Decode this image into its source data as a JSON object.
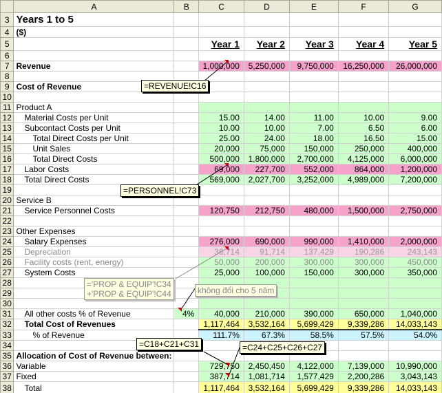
{
  "columns": [
    "",
    "A",
    "B",
    "C",
    "D",
    "E",
    "F",
    "G"
  ],
  "rows": [
    {
      "n": "3",
      "a": "Years 1 to 5",
      "b": "",
      "v": [
        "",
        "",
        "",
        "",
        ""
      ],
      "cls": "big",
      "fill": ""
    },
    {
      "n": "4",
      "a": "($)",
      "b": "",
      "v": [
        "",
        "",
        "",
        "",
        ""
      ],
      "cls": "bold",
      "fill": ""
    },
    {
      "n": "5",
      "a": "",
      "b": "",
      "v": [
        "Year 1",
        "Year 2",
        "Year 3",
        "Year 4",
        "Year 5"
      ],
      "cls": "yr",
      "fill": ""
    },
    {
      "n": "6",
      "a": "",
      "b": "",
      "v": [
        "",
        "",
        "",
        "",
        ""
      ],
      "cls": "",
      "fill": ""
    },
    {
      "n": "7",
      "a": "Revenue",
      "b": "",
      "v": [
        "1,000,000",
        "5,250,000",
        "9,750,000",
        "16,250,000",
        "26,000,000"
      ],
      "cls": "bold",
      "fill": "pink"
    },
    {
      "n": "8",
      "a": "",
      "b": "",
      "v": [
        "",
        "",
        "",
        "",
        ""
      ],
      "cls": "",
      "fill": ""
    },
    {
      "n": "9",
      "a": "Cost of Revenue",
      "b": "",
      "v": [
        "",
        "",
        "",
        "",
        ""
      ],
      "cls": "bold",
      "fill": ""
    },
    {
      "n": "10",
      "a": "",
      "b": "",
      "v": [
        "",
        "",
        "",
        "",
        ""
      ],
      "cls": "",
      "fill": ""
    },
    {
      "n": "11",
      "a": "Product A",
      "b": "",
      "v": [
        "",
        "",
        "",
        "",
        ""
      ],
      "cls": "",
      "fill": "green"
    },
    {
      "n": "12",
      "a": "Material Costs per Unit",
      "b": "",
      "v": [
        "15.00",
        "14.00",
        "11.00",
        "10.00",
        "9.00"
      ],
      "cls": "ind1",
      "fill": "green"
    },
    {
      "n": "13",
      "a": "Subcontact Costs per Unit",
      "b": "",
      "v": [
        "10.00",
        "10.00",
        "7.00",
        "6.50",
        "6.00"
      ],
      "cls": "ind1",
      "fill": "green"
    },
    {
      "n": "14",
      "a": "Total Direct Costs per Unit",
      "b": "",
      "v": [
        "25.00",
        "24.00",
        "18.00",
        "16.50",
        "15.00"
      ],
      "cls": "ind2",
      "fill": "green"
    },
    {
      "n": "15",
      "a": "Unit Sales",
      "b": "",
      "v": [
        "20,000",
        "75,000",
        "150,000",
        "250,000",
        "400,000"
      ],
      "cls": "ind2",
      "fill": "green"
    },
    {
      "n": "16",
      "a": "Total Direct Costs",
      "b": "",
      "v": [
        "500,000",
        "1,800,000",
        "2,700,000",
        "4,125,000",
        "6,000,000"
      ],
      "cls": "ind2",
      "fill": "green"
    },
    {
      "n": "17",
      "a": "Labor Costs",
      "b": "",
      "v": [
        "69,000",
        "227,700",
        "552,000",
        "864,000",
        "1,200,000"
      ],
      "cls": "ind1",
      "fill": "pink"
    },
    {
      "n": "18",
      "a": "Total Direct Costs",
      "b": "",
      "v": [
        "569,000",
        "2,027,700",
        "3,252,000",
        "4,989,000",
        "7,200,000"
      ],
      "cls": "ind1",
      "fill": "green"
    },
    {
      "n": "19",
      "a": "",
      "b": "",
      "v": [
        "",
        "",
        "",
        "",
        ""
      ],
      "cls": "",
      "fill": ""
    },
    {
      "n": "20",
      "a": "Service B",
      "b": "",
      "v": [
        "",
        "",
        "",
        "",
        ""
      ],
      "cls": "",
      "fill": ""
    },
    {
      "n": "21",
      "a": "Service Personnel Costs",
      "b": "",
      "v": [
        "120,750",
        "212,750",
        "480,000",
        "1,500,000",
        "2,750,000"
      ],
      "cls": "ind1",
      "fill": "pink"
    },
    {
      "n": "22",
      "a": "",
      "b": "",
      "v": [
        "",
        "",
        "",
        "",
        ""
      ],
      "cls": "",
      "fill": ""
    },
    {
      "n": "23",
      "a": "Other Expenses",
      "b": "",
      "v": [
        "",
        "",
        "",
        "",
        ""
      ],
      "cls": "",
      "fill": ""
    },
    {
      "n": "24",
      "a": "Salary Expenses",
      "b": "",
      "v": [
        "276,000",
        "690,000",
        "990,000",
        "1,410,000",
        "2,000,000"
      ],
      "cls": "ind1",
      "fill": "pink"
    },
    {
      "n": "25",
      "a": "Depreciation",
      "b": "",
      "v": [
        "36,714",
        "91,714",
        "137,429",
        "190,286",
        "243,143"
      ],
      "cls": "ind1 gray",
      "fill": "lpink"
    },
    {
      "n": "26",
      "a": "Facility costs (rent, energy)",
      "b": "",
      "v": [
        "50,000",
        "200,000",
        "300,000",
        "300,000",
        "450,000"
      ],
      "cls": "ind1 gray",
      "fill": "greengray"
    },
    {
      "n": "27",
      "a": "System Costs",
      "b": "",
      "v": [
        "25,000",
        "100,000",
        "150,000",
        "300,000",
        "350,000"
      ],
      "cls": "ind1",
      "fill": "green"
    },
    {
      "n": "28",
      "a": "",
      "b": "",
      "v": [
        "",
        "",
        "",
        "",
        ""
      ],
      "cls": "",
      "fill": "green"
    },
    {
      "n": "29",
      "a": "",
      "b": "",
      "v": [
        "",
        "",
        "",
        "",
        ""
      ],
      "cls": "",
      "fill": "green"
    },
    {
      "n": "30",
      "a": "",
      "b": "",
      "v": [
        "",
        "",
        "",
        "",
        ""
      ],
      "cls": "",
      "fill": "green"
    },
    {
      "n": "31",
      "a": "All other costs % of Revenue",
      "b": "4%",
      "v": [
        "40,000",
        "210,000",
        "390,000",
        "650,000",
        "1,040,000"
      ],
      "cls": "ind1",
      "fill": "green"
    },
    {
      "n": "32",
      "a": "Total Cost of Revenues",
      "b": "",
      "v": [
        "1,117,464",
        "3,532,164",
        "5,699,429",
        "9,339,286",
        "14,033,143"
      ],
      "cls": "ind1 bold",
      "fill": "yellow"
    },
    {
      "n": "33",
      "a": "% of Revenue",
      "b": "",
      "v": [
        "111.7%",
        "67.3%",
        "58.5%",
        "57.5%",
        "54.0%"
      ],
      "cls": "ind2",
      "fill": "cyan"
    },
    {
      "n": "34",
      "a": "",
      "b": "",
      "v": [
        "",
        "",
        "",
        "",
        ""
      ],
      "cls": "",
      "fill": ""
    },
    {
      "n": "35",
      "a": "Allocation of Cost of Revenue between:",
      "b": "",
      "v": [
        "",
        "",
        "",
        "",
        ""
      ],
      "cls": "bold",
      "fill": ""
    },
    {
      "n": "36",
      "a": "Variable",
      "b": "",
      "v": [
        "729,750",
        "2,450,450",
        "4,122,000",
        "7,139,000",
        "10,990,000"
      ],
      "cls": "",
      "fill": "green"
    },
    {
      "n": "37",
      "a": "Fixed",
      "b": "",
      "v": [
        "387,714",
        "1,081,714",
        "1,577,429",
        "2,200,286",
        "3,043,143"
      ],
      "cls": "",
      "fill": "green"
    },
    {
      "n": "38",
      "a": "Total",
      "b": "",
      "v": [
        "1,117,464",
        "3,532,164",
        "5,699,429",
        "9,339,286",
        "14,033,143"
      ],
      "cls": "ind1",
      "fill": "yellow"
    }
  ],
  "comments": [
    {
      "text": "=REVENUE!C16",
      "style": ""
    },
    {
      "text": "=PERSONNEL!C73",
      "style": ""
    },
    {
      "text": "='PROP & EQUIP'!C34\n+'PROP & EQUIP'!C44",
      "style": "soft"
    },
    {
      "text": "không đổi cho 5 năm",
      "style": "soft"
    },
    {
      "text": "=C18+C21+C31",
      "style": ""
    },
    {
      "text": "=C24+C25+C26+C27",
      "style": ""
    }
  ],
  "colors": {
    "pink": "#f5a3cb",
    "green": "#ccffcc",
    "yellow": "#ffff99",
    "cyan": "#ccf4ff",
    "comment": "#ffffe1"
  }
}
